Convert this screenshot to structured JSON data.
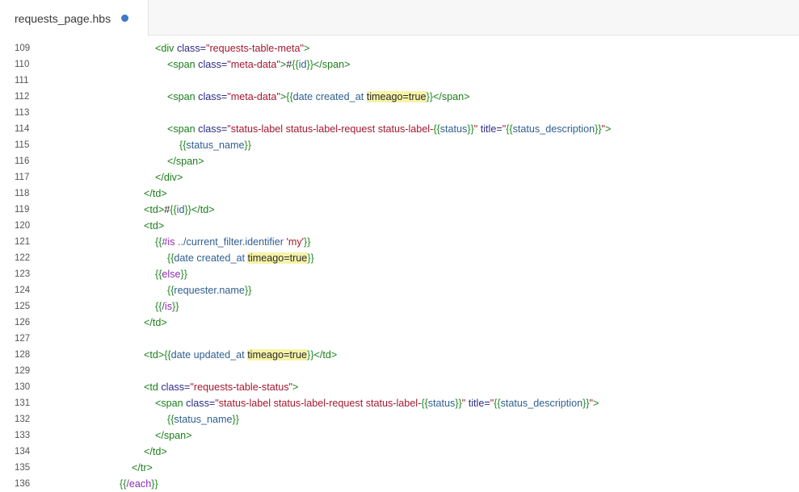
{
  "tab": {
    "filename": "requests_page.hbs",
    "modified_dot": "unsaved-indicator"
  },
  "lines": [
    {
      "n": "109",
      "indent": 192,
      "tokens": [
        [
          "tag",
          "<div "
        ],
        [
          "attr",
          "class="
        ],
        [
          "str",
          "\"requests-table-meta\""
        ],
        [
          "tag",
          ">"
        ]
      ]
    },
    {
      "n": "110",
      "indent": 207,
      "tokens": [
        [
          "tag",
          "<span "
        ],
        [
          "attr",
          "class="
        ],
        [
          "str",
          "\"meta-data\""
        ],
        [
          "tag",
          ">"
        ],
        [
          "txt",
          "#"
        ],
        [
          "hb",
          "{{"
        ],
        [
          "var",
          "id"
        ],
        [
          "hb",
          "}}"
        ],
        [
          "tag",
          "</span>"
        ]
      ]
    },
    {
      "n": "111",
      "indent": 207,
      "tokens": []
    },
    {
      "n": "112",
      "indent": 207,
      "tokens": [
        [
          "tag",
          "<span "
        ],
        [
          "attr",
          "class="
        ],
        [
          "str",
          "\"meta-data\""
        ],
        [
          "tag",
          ">"
        ],
        [
          "hb",
          "{{"
        ],
        [
          "var",
          "date created_at "
        ],
        [
          "hl",
          "timeago=true"
        ],
        [
          "hb",
          "}}"
        ],
        [
          "tag",
          "</span>"
        ]
      ]
    },
    {
      "n": "113",
      "indent": 207,
      "tokens": []
    },
    {
      "n": "114",
      "indent": 207,
      "tokens": [
        [
          "tag",
          "<span "
        ],
        [
          "attr",
          "class="
        ],
        [
          "str",
          "\"status-label status-label-request status-label-"
        ],
        [
          "hb",
          "{{"
        ],
        [
          "var",
          "status"
        ],
        [
          "hb",
          "}}"
        ],
        [
          "str",
          "\""
        ],
        [
          "attr",
          " title="
        ],
        [
          "str",
          "\""
        ],
        [
          "hb",
          "{{"
        ],
        [
          "var",
          "status_description"
        ],
        [
          "hb",
          "}}"
        ],
        [
          "str",
          "\""
        ],
        [
          "tag",
          ">"
        ]
      ]
    },
    {
      "n": "115",
      "indent": 222,
      "tokens": [
        [
          "hb",
          "{{"
        ],
        [
          "var",
          "status_name"
        ],
        [
          "hb",
          "}}"
        ]
      ]
    },
    {
      "n": "116",
      "indent": 207,
      "tokens": [
        [
          "tag",
          "</span>"
        ]
      ]
    },
    {
      "n": "117",
      "indent": 192,
      "tokens": [
        [
          "tag",
          "</div>"
        ]
      ]
    },
    {
      "n": "118",
      "indent": 178,
      "tokens": [
        [
          "tag",
          "</td>"
        ]
      ]
    },
    {
      "n": "119",
      "indent": 178,
      "tokens": [
        [
          "tag",
          "<td>"
        ],
        [
          "txt",
          "#"
        ],
        [
          "hb",
          "{{"
        ],
        [
          "var",
          "id"
        ],
        [
          "hb",
          "}}"
        ],
        [
          "tag",
          "</td>"
        ]
      ]
    },
    {
      "n": "120",
      "indent": 178,
      "tokens": [
        [
          "tag",
          "<td>"
        ]
      ]
    },
    {
      "n": "121",
      "indent": 192,
      "tokens": [
        [
          "hb",
          "{{"
        ],
        [
          "kw",
          "#is"
        ],
        [
          "var",
          " ../current_filter.identifier "
        ],
        [
          "str",
          "'my'"
        ],
        [
          "hb",
          "}}"
        ]
      ]
    },
    {
      "n": "122",
      "indent": 207,
      "tokens": [
        [
          "hb",
          "{{"
        ],
        [
          "var",
          "date created_at "
        ],
        [
          "hl",
          "timeago=true"
        ],
        [
          "hb",
          "}}"
        ]
      ]
    },
    {
      "n": "123",
      "indent": 192,
      "tokens": [
        [
          "hb",
          "{{"
        ],
        [
          "kw",
          "else"
        ],
        [
          "hb",
          "}}"
        ]
      ]
    },
    {
      "n": "124",
      "indent": 207,
      "tokens": [
        [
          "hb",
          "{{"
        ],
        [
          "var",
          "requester.name"
        ],
        [
          "hb",
          "}}"
        ]
      ]
    },
    {
      "n": "125",
      "indent": 192,
      "tokens": [
        [
          "hb",
          "{{"
        ],
        [
          "kw",
          "/is"
        ],
        [
          "hb",
          "}}"
        ]
      ]
    },
    {
      "n": "126",
      "indent": 178,
      "tokens": [
        [
          "tag",
          "</td>"
        ]
      ]
    },
    {
      "n": "127",
      "indent": 178,
      "tokens": []
    },
    {
      "n": "128",
      "indent": 178,
      "tokens": [
        [
          "tag",
          "<td>"
        ],
        [
          "hb",
          "{{"
        ],
        [
          "var",
          "date updated_at "
        ],
        [
          "hl",
          "timeago=true"
        ],
        [
          "hb",
          "}}"
        ],
        [
          "tag",
          "</td>"
        ]
      ]
    },
    {
      "n": "129",
      "indent": 178,
      "tokens": []
    },
    {
      "n": "130",
      "indent": 178,
      "tokens": [
        [
          "tag",
          "<td "
        ],
        [
          "attr",
          "class="
        ],
        [
          "str",
          "\"requests-table-status\""
        ],
        [
          "tag",
          ">"
        ]
      ]
    },
    {
      "n": "131",
      "indent": 192,
      "tokens": [
        [
          "tag",
          "<span "
        ],
        [
          "attr",
          "class="
        ],
        [
          "str",
          "\"status-label status-label-request status-label-"
        ],
        [
          "hb",
          "{{"
        ],
        [
          "var",
          "status"
        ],
        [
          "hb",
          "}}"
        ],
        [
          "str",
          "\""
        ],
        [
          "attr",
          " title="
        ],
        [
          "str",
          "\""
        ],
        [
          "hb",
          "{{"
        ],
        [
          "var",
          "status_description"
        ],
        [
          "hb",
          "}}"
        ],
        [
          "str",
          "\""
        ],
        [
          "tag",
          ">"
        ]
      ]
    },
    {
      "n": "132",
      "indent": 207,
      "tokens": [
        [
          "hb",
          "{{"
        ],
        [
          "var",
          "status_name"
        ],
        [
          "hb",
          "}}"
        ]
      ]
    },
    {
      "n": "133",
      "indent": 192,
      "tokens": [
        [
          "tag",
          "</span>"
        ]
      ]
    },
    {
      "n": "134",
      "indent": 178,
      "tokens": [
        [
          "tag",
          "</td>"
        ]
      ]
    },
    {
      "n": "135",
      "indent": 163,
      "tokens": [
        [
          "tag",
          "</tr>"
        ]
      ]
    },
    {
      "n": "136",
      "indent": 148,
      "tokens": [
        [
          "hb",
          "{{"
        ],
        [
          "kw",
          "/each"
        ],
        [
          "hb",
          "}}"
        ]
      ]
    }
  ]
}
